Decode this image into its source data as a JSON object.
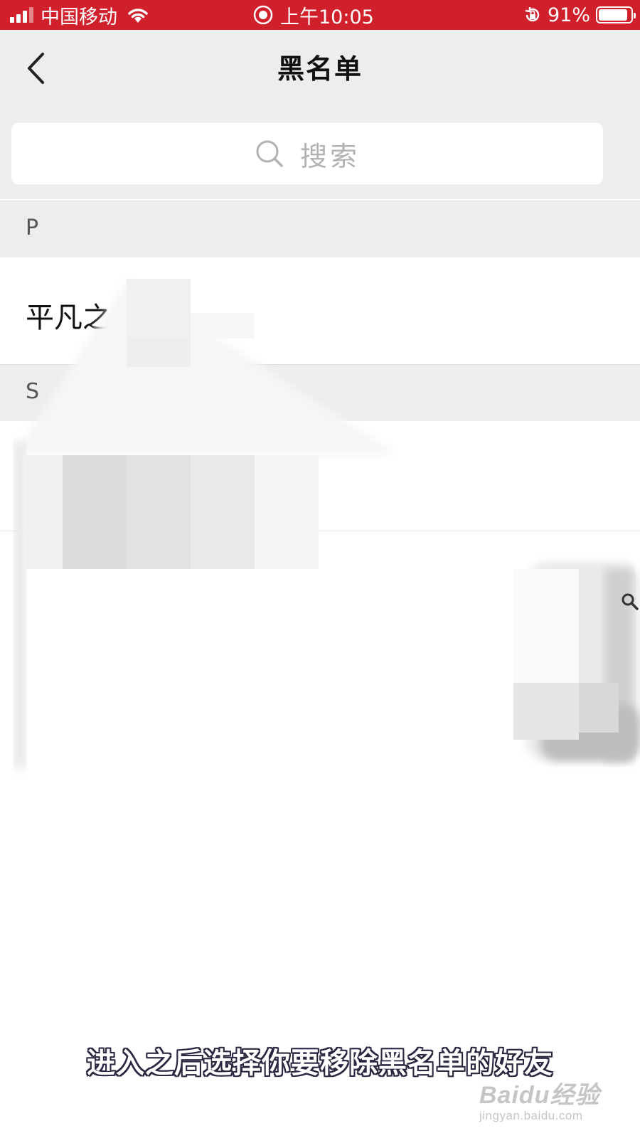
{
  "status_bar": {
    "carrier": "中国移动",
    "time": "上午10:05",
    "battery": "91%",
    "battery_level": 0.91,
    "background_color": "#d0202b",
    "icons": [
      "signal-icon",
      "wifi-icon",
      "screen-record-icon",
      "rotation-lock-icon",
      "battery-icon"
    ]
  },
  "nav": {
    "title": "黑名单",
    "back_icon": "chevron-left-icon"
  },
  "search": {
    "placeholder": "搜索",
    "icon": "search-icon"
  },
  "sections": [
    {
      "letter": "P",
      "items": [
        "平凡之"
      ]
    },
    {
      "letter": "S",
      "items": [
        ""
      ]
    }
  ],
  "caption": "进入之后选择你要移除黑名单的好友",
  "watermark": {
    "brand": "Baidu经验",
    "url": "jingyan.baidu.com"
  }
}
